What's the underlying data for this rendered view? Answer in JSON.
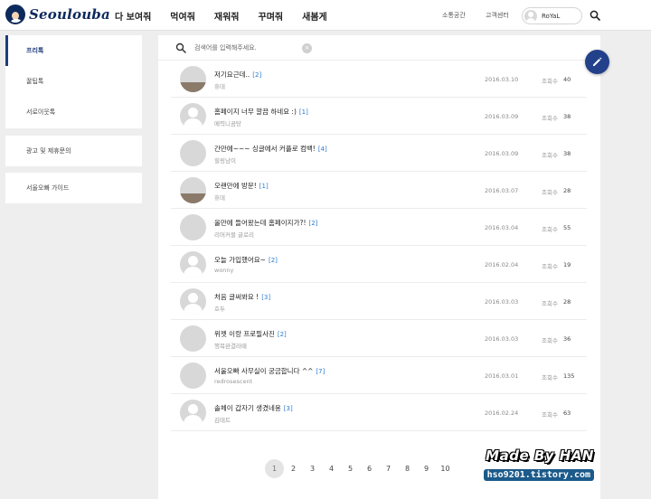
{
  "header": {
    "logo_text": "Seoulouba",
    "nav": [
      "다 보여줘",
      "먹여줘",
      "재워줘",
      "꾸며줘",
      "새봄게"
    ],
    "support_label": "소통공간",
    "service_label": "고객센터",
    "user_name": "RoYaL"
  },
  "sidebar": {
    "group1": [
      "프리톡",
      "꿀팁톡",
      "서로이웃톡"
    ],
    "group2": "광고 및 제휴문의",
    "group3": "서울오빠 가이드"
  },
  "search": {
    "placeholder": "검색어를 입력해주세요.",
    "clear_symbol": "×"
  },
  "views_label": "조회수",
  "posts": [
    {
      "title": "저기요근데..",
      "comments": "[2]",
      "author": "휴데",
      "date": "2016.03.10",
      "views": "40",
      "avatar": "cat"
    },
    {
      "title": "홈페이지 너무 깔끔 하네요 :)",
      "comments": "[1]",
      "author": "메력니곰탕",
      "date": "2016.03.09",
      "views": "38",
      "avatar": "default"
    },
    {
      "title": "간만에~~~ 싱글에서 커플로 컴백!",
      "comments": "[4]",
      "author": "힐링남이",
      "date": "2016.03.09",
      "views": "38",
      "avatar": "girl"
    },
    {
      "title": "오랜만에 방문!",
      "comments": "[1]",
      "author": "휴데",
      "date": "2016.03.07",
      "views": "28",
      "avatar": "cat"
    },
    {
      "title": "올만에 들어왔는데 홈페이지가?!",
      "comments": "[2]",
      "author": "리머커블 글로리",
      "date": "2016.03.04",
      "views": "55",
      "avatar": "coffee"
    },
    {
      "title": "오늘 가입했어요~",
      "comments": "[2]",
      "author": "wonny",
      "date": "2016.02.04",
      "views": "19",
      "avatar": "default"
    },
    {
      "title": "처음 글써봐요 !",
      "comments": "[3]",
      "author": "호두",
      "date": "2016.03.03",
      "views": "28",
      "avatar": "default"
    },
    {
      "title": "위젯 이랑 프로필사진",
      "comments": "[2]",
      "author": "행복완결라떼",
      "date": "2016.03.03",
      "views": "36",
      "avatar": "dark"
    },
    {
      "title": "서울오빠 사무실이 궁금합니다 ^^",
      "comments": "[7]",
      "author": "redrosescent",
      "date": "2016.03.01",
      "views": "135",
      "avatar": "rose"
    },
    {
      "title": "솔체이 갑자기 생겼네용",
      "comments": "[3]",
      "author": "김태트",
      "date": "2016.02.24",
      "views": "63",
      "avatar": "default"
    }
  ],
  "pagination": [
    "1",
    "2",
    "3",
    "4",
    "5",
    "6",
    "7",
    "8",
    "9",
    "10"
  ],
  "current_page": "1",
  "watermark": {
    "line1": "Made By HAN",
    "line2": "hso9201.tistory.com"
  },
  "colors": {
    "brand": "#0d2a5c",
    "accent": "#23408a",
    "comment_count": "#2b7bd0"
  }
}
